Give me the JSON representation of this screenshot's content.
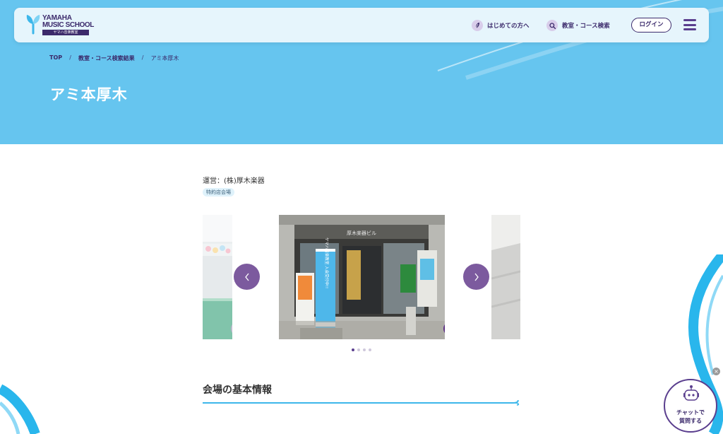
{
  "header": {
    "logo_line1": "YAMAHA",
    "logo_line2": "MUSIC SCHOOL",
    "logo_sub": "ヤマハ音楽教室",
    "nav_beginner": "はじめての方へ",
    "nav_search": "教室・コース検索",
    "login_label": "ログイン"
  },
  "breadcrumb": {
    "items": [
      "TOP",
      "教室・コース検索結果",
      "アミ本厚木"
    ],
    "separator": "/"
  },
  "page": {
    "title": "アミ本厚木",
    "operator": "運営：(株)厚木楽器",
    "badge": "特約店会場"
  },
  "carousel": {
    "store_sign": "厚木楽器ビル",
    "banner_text": "ヤマハ音楽教室 入会受付中!!",
    "slide_count": 4,
    "active_index": 0
  },
  "section": {
    "title": "会場の基本情報"
  },
  "chat": {
    "line1": "チャットで",
    "line2": "質問する",
    "close_glyph": "×"
  },
  "colors": {
    "hero_bg": "#66c5ef",
    "brand_purple": "#3b2a6b",
    "accent_purple": "#7c5a9e",
    "accent_blue": "#3db7ea"
  }
}
